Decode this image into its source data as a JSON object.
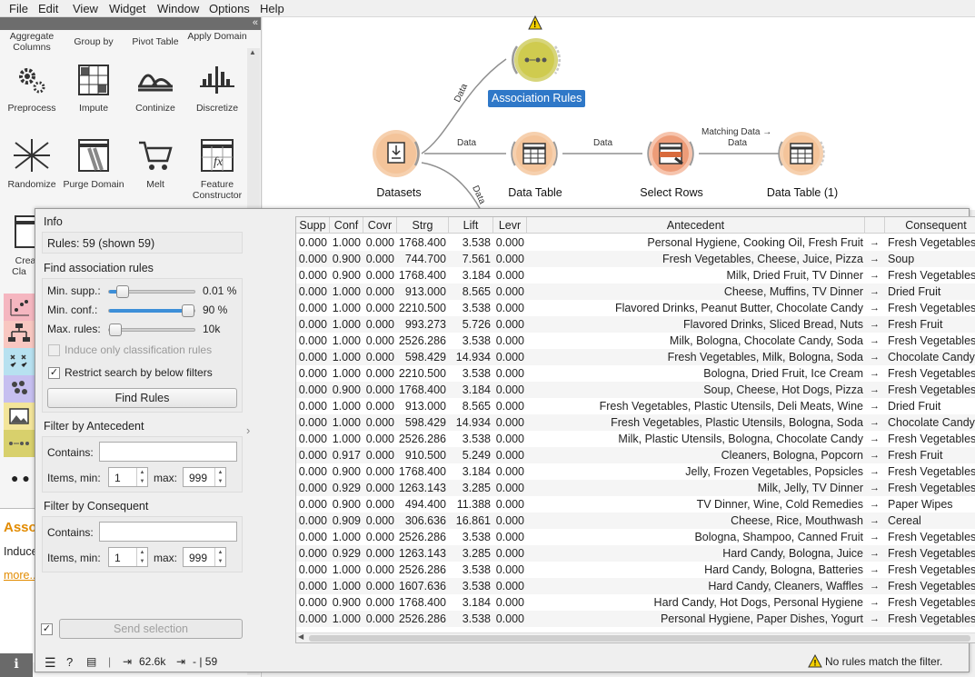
{
  "menu": [
    "File",
    "Edit",
    "View",
    "Widget",
    "Window",
    "Options",
    "Help"
  ],
  "tools": {
    "row0": [
      "Aggregate Columns",
      "Group by",
      "Pivot Table",
      "Apply Domain"
    ],
    "row1": [
      "Preprocess",
      "Impute",
      "Continize",
      "Discretize"
    ],
    "row2": [
      "Randomize",
      "Purge Domain",
      "Melt",
      "Feature Constructor"
    ],
    "row3": [
      "Crea Cla"
    ]
  },
  "info_panel": {
    "title": "Asso",
    "body": "Induce",
    "link": "more..."
  },
  "canvas": {
    "nodes": {
      "assoc": "Association Rules",
      "datasets": "Datasets",
      "table": "Data Table",
      "select": "Select Rows",
      "table1": "Data Table (1)"
    },
    "links": {
      "l1": "Data",
      "l2": "Data",
      "l3": "Data",
      "l4": "Matching Data →",
      "l4b": "Data",
      "l5": "Data"
    },
    "warning": "!"
  },
  "dialog": {
    "info_title": "Info",
    "info_text": "Rules: 59 (shown 59)",
    "find_title": "Find association rules",
    "min_supp": {
      "label": "Min. supp.:",
      "value": "0.01 %",
      "level": 0.08
    },
    "min_conf": {
      "label": "Min. conf.:",
      "value": "90 %",
      "level": 0.9
    },
    "max_rules": {
      "label": "Max. rules:",
      "value": "10k",
      "level": 0.02
    },
    "induce_label": "Induce only classification rules",
    "restrict_label": "Restrict search by below filters",
    "find_button": "Find Rules",
    "ante_title": "Filter by Antecedent",
    "cons_title": "Filter by Consequent",
    "contains": "Contains:",
    "items_min": "Items, min:",
    "max": "max:",
    "ante_min": "1",
    "ante_max": "999",
    "cons_min": "1",
    "cons_max": "999",
    "send": "Send selection",
    "check": "✓"
  },
  "table": {
    "headers": [
      "Supp",
      "Conf",
      "Covr",
      "Strg",
      "Lift",
      "Levr",
      "Antecedent",
      "",
      "Consequent"
    ],
    "arrow": "→",
    "rows": [
      [
        "0.000",
        "1.000",
        "0.000",
        "1768.400",
        "3.538",
        "0.000",
        "Personal Hygiene, Cooking Oil, Fresh Fruit",
        "Fresh Vegetables"
      ],
      [
        "0.000",
        "0.900",
        "0.000",
        "744.700",
        "7.561",
        "0.000",
        "Fresh Vegetables, Cheese, Juice, Pizza",
        "Soup"
      ],
      [
        "0.000",
        "0.900",
        "0.000",
        "1768.400",
        "3.184",
        "0.000",
        "Milk, Dried Fruit, TV Dinner",
        "Fresh Vegetables"
      ],
      [
        "0.000",
        "1.000",
        "0.000",
        "913.000",
        "8.565",
        "0.000",
        "Cheese, Muffins, TV Dinner",
        "Dried Fruit"
      ],
      [
        "0.000",
        "1.000",
        "0.000",
        "2210.500",
        "3.538",
        "0.000",
        "Flavored Drinks, Peanut Butter, Chocolate Candy",
        "Fresh Vegetables"
      ],
      [
        "0.000",
        "1.000",
        "0.000",
        "993.273",
        "5.726",
        "0.000",
        "Flavored Drinks, Sliced Bread, Nuts",
        "Fresh Fruit"
      ],
      [
        "0.000",
        "1.000",
        "0.000",
        "2526.286",
        "3.538",
        "0.000",
        "Milk, Bologna, Chocolate Candy, Soda",
        "Fresh Vegetables"
      ],
      [
        "0.000",
        "1.000",
        "0.000",
        "598.429",
        "14.934",
        "0.000",
        "Fresh Vegetables, Milk, Bologna, Soda",
        "Chocolate Candy"
      ],
      [
        "0.000",
        "1.000",
        "0.000",
        "2210.500",
        "3.538",
        "0.000",
        "Bologna, Dried Fruit, Ice Cream",
        "Fresh Vegetables"
      ],
      [
        "0.000",
        "0.900",
        "0.000",
        "1768.400",
        "3.184",
        "0.000",
        "Soup, Cheese, Hot Dogs, Pizza",
        "Fresh Vegetables"
      ],
      [
        "0.000",
        "1.000",
        "0.000",
        "913.000",
        "8.565",
        "0.000",
        "Fresh Vegetables, Plastic Utensils, Deli Meats, Wine",
        "Dried Fruit"
      ],
      [
        "0.000",
        "1.000",
        "0.000",
        "598.429",
        "14.934",
        "0.000",
        "Fresh Vegetables, Plastic Utensils, Bologna, Soda",
        "Chocolate Candy"
      ],
      [
        "0.000",
        "1.000",
        "0.000",
        "2526.286",
        "3.538",
        "0.000",
        "Milk, Plastic Utensils, Bologna, Chocolate Candy",
        "Fresh Vegetables"
      ],
      [
        "0.000",
        "0.917",
        "0.000",
        "910.500",
        "5.249",
        "0.000",
        "Cleaners, Bologna, Popcorn",
        "Fresh Fruit"
      ],
      [
        "0.000",
        "0.900",
        "0.000",
        "1768.400",
        "3.184",
        "0.000",
        "Jelly, Frozen Vegetables, Popsicles",
        "Fresh Vegetables"
      ],
      [
        "0.000",
        "0.929",
        "0.000",
        "1263.143",
        "3.285",
        "0.000",
        "Milk, Jelly, TV Dinner",
        "Fresh Vegetables"
      ],
      [
        "0.000",
        "0.900",
        "0.000",
        "494.400",
        "11.388",
        "0.000",
        "TV Dinner, Wine, Cold Remedies",
        "Paper Wipes"
      ],
      [
        "0.000",
        "0.909",
        "0.000",
        "306.636",
        "16.861",
        "0.000",
        "Cheese, Rice, Mouthwash",
        "Cereal"
      ],
      [
        "0.000",
        "1.000",
        "0.000",
        "2526.286",
        "3.538",
        "0.000",
        "Bologna, Shampoo, Canned Fruit",
        "Fresh Vegetables"
      ],
      [
        "0.000",
        "0.929",
        "0.000",
        "1263.143",
        "3.285",
        "0.000",
        "Hard Candy, Bologna, Juice",
        "Fresh Vegetables"
      ],
      [
        "0.000",
        "1.000",
        "0.000",
        "2526.286",
        "3.538",
        "0.000",
        "Hard Candy, Bologna, Batteries",
        "Fresh Vegetables"
      ],
      [
        "0.000",
        "1.000",
        "0.000",
        "1607.636",
        "3.538",
        "0.000",
        "Hard Candy, Cleaners, Waffles",
        "Fresh Vegetables"
      ],
      [
        "0.000",
        "0.900",
        "0.000",
        "1768.400",
        "3.184",
        "0.000",
        "Hard Candy, Hot Dogs, Personal Hygiene",
        "Fresh Vegetables"
      ],
      [
        "0.000",
        "1.000",
        "0.000",
        "2526.286",
        "3.538",
        "0.000",
        "Personal Hygiene, Paper Dishes, Yogurt",
        "Fresh Vegetables"
      ]
    ]
  },
  "status": {
    "count": "62.6k",
    "out": "- | 59",
    "message": "No rules match the filter."
  }
}
